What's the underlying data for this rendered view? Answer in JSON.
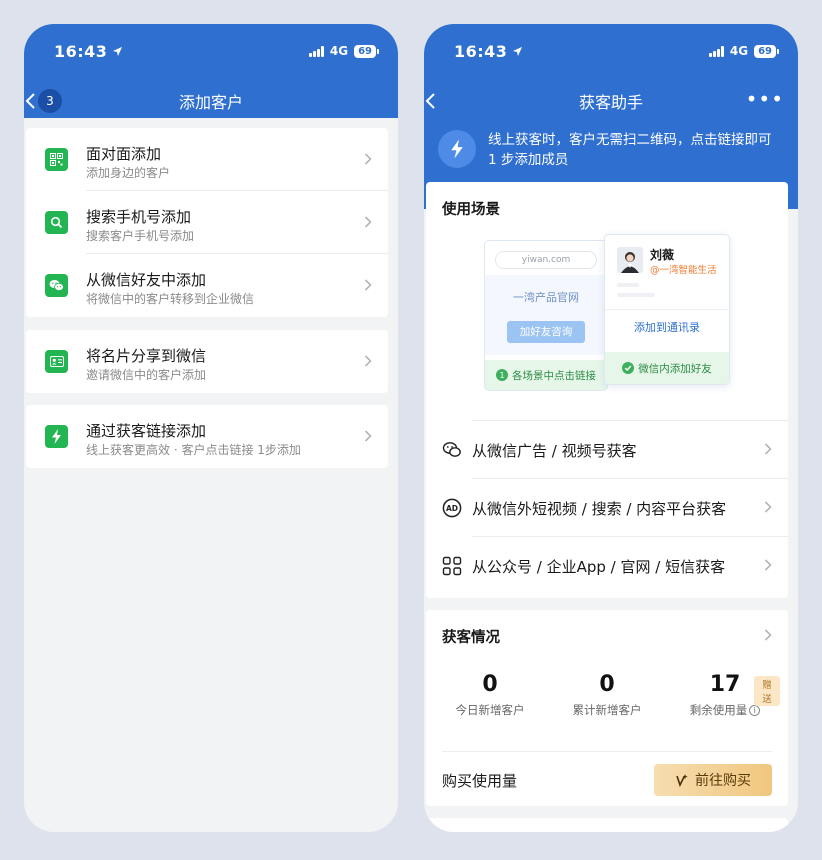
{
  "left": {
    "status": {
      "time": "16:43",
      "network": "4G",
      "battery": "69"
    },
    "nav": {
      "title": "添加客户",
      "badge": "3"
    },
    "items": [
      {
        "title": "面对面添加",
        "subtitle": "添加身边的客户",
        "icon": "qrcode-icon"
      },
      {
        "title": "搜索手机号添加",
        "subtitle": "搜索客户手机号添加",
        "icon": "search-icon"
      },
      {
        "title": "从微信好友中添加",
        "subtitle": "将微信中的客户转移到企业微信",
        "icon": "wechat-icon"
      },
      {
        "title": "将名片分享到微信",
        "subtitle": "邀请微信中的客户添加",
        "icon": "card-icon"
      },
      {
        "title": "通过获客链接添加",
        "subtitle": "线上获客更高效 · 客户点击链接 1步添加",
        "icon": "bolt-icon"
      }
    ]
  },
  "right": {
    "status": {
      "time": "16:43",
      "network": "4G",
      "battery": "69"
    },
    "nav": {
      "title": "获客助手",
      "more": "•••"
    },
    "banner": {
      "text": "线上获客时，客户无需扫二维码，点击链接即可 1 步添加成员"
    },
    "scene": {
      "title": "使用场景",
      "illustration": {
        "url": "yiwan.com",
        "site_name": "一湾产品官网",
        "add_button": "加好友咨询",
        "tip_left_num": "1",
        "tip_left": "各场景中点击链接",
        "person_name": "刘薇",
        "person_company": "@一湾智能生活",
        "add_contact": "添加到通讯录",
        "tip_right": "微信内添加好友"
      },
      "sources": [
        {
          "label": "从微信广告 / 视频号获客",
          "icon": "wechat-ad-icon"
        },
        {
          "label": "从微信外短视频 / 搜索 / 内容平台获客",
          "icon": "ad-icon"
        },
        {
          "label": "从公众号 / 企业App / 官网 / 短信获客",
          "icon": "grid-apps-icon"
        }
      ]
    },
    "stats": {
      "title": "获客情况",
      "items": [
        {
          "value": "0",
          "label": "今日新增客户"
        },
        {
          "value": "0",
          "label": "累计新增客户"
        },
        {
          "value": "17",
          "label": "剩余使用量",
          "tag": "赠送",
          "info": "i"
        }
      ],
      "buy_label": "购买使用量",
      "buy_button": "前往购买"
    },
    "colors": {
      "primary": "#2f6fd0",
      "green": "#24b553",
      "gold": "#f0c77f"
    }
  }
}
